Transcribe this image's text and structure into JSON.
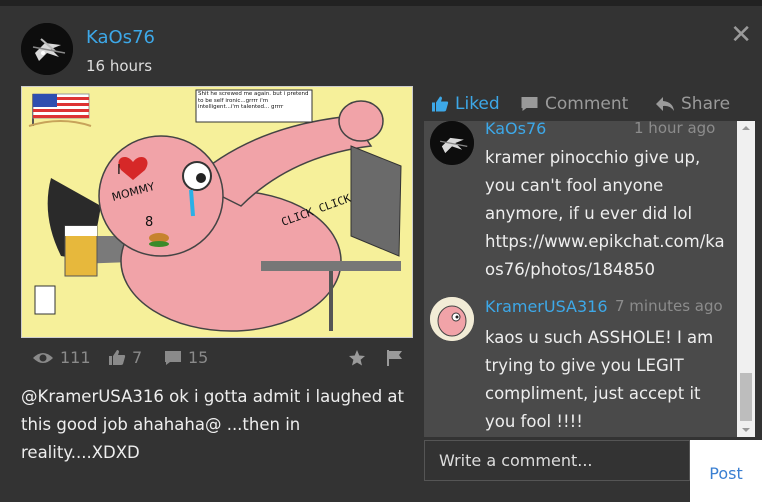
{
  "post": {
    "username": "KaOs76",
    "time": "16 hours",
    "caption": "@KramerUSA316 ok i gotta admit i laughed at this good job ahahaha@ ...then in reality....XDXD",
    "views": "111",
    "likes": "7",
    "comments": "15",
    "photo": {
      "speech_bubble": "Shit he screwed me again. but i pretend to be self ironic...grrrr i'm intelligent...i'm talented... grrrr",
      "tattoo_top": "I",
      "tattoo_bottom": "MOMMY",
      "tattoo_number": "8",
      "click_text": "CLICK CLICK"
    }
  },
  "actions": {
    "liked_label": "Liked",
    "comment_label": "Comment",
    "share_label": "Share"
  },
  "comments": [
    {
      "username": "KaOs76",
      "time": "1 hour ago",
      "text": "kramer pinocchio give up, you can't fool anyone anymore, if u ever did lol https://www.epikchat.com/kaos76/photos/184850"
    },
    {
      "username": "KramerUSA316",
      "time": "7 minutes ago",
      "text": "kaos u such ASSHOLE! I am trying to give you LEGIT compliment, just accept it you fool !!!!"
    }
  ],
  "composer": {
    "placeholder": "Write a comment...",
    "post_label": "Post"
  },
  "colors": {
    "accent": "#3da8e8",
    "panel": "#4a4a4a",
    "background": "#333333"
  }
}
